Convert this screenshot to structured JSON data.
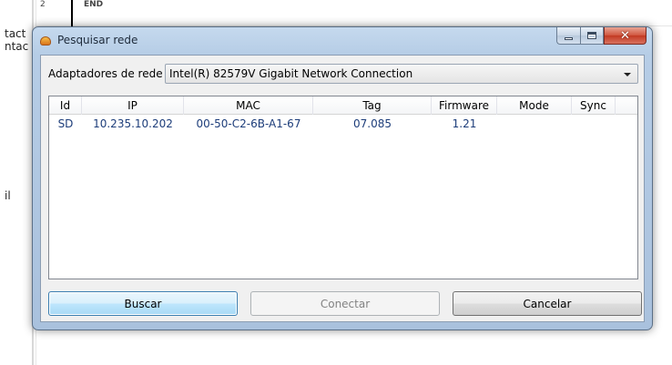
{
  "background": {
    "left_fragments": [
      "tact",
      "ntac",
      "il"
    ],
    "top_fragments": [
      "2",
      "END"
    ]
  },
  "dialog": {
    "title": "Pesquisar rede",
    "caption_buttons": {
      "minimize": "minimize-icon",
      "maximize": "maximize-icon",
      "close": "close-icon"
    },
    "adapter_label": "Adaptadores de rede",
    "adapter_selected": "Intel(R) 82579V Gigabit Network Connection",
    "columns": [
      "Id",
      "IP",
      "MAC",
      "Tag",
      "Firmware",
      "Mode",
      "Sync"
    ],
    "rows": [
      [
        "SD",
        "10.235.10.202",
        "00-50-C2-6B-A1-67",
        "07.085",
        "1.21",
        "",
        ""
      ]
    ],
    "buttons": {
      "search": "Buscar",
      "connect": "Conectar",
      "cancel": "Cancelar"
    },
    "colors": {
      "title_gradient": "#b6cde6",
      "row_text": "#1d3d7a",
      "close_button": "#c23a22"
    }
  }
}
